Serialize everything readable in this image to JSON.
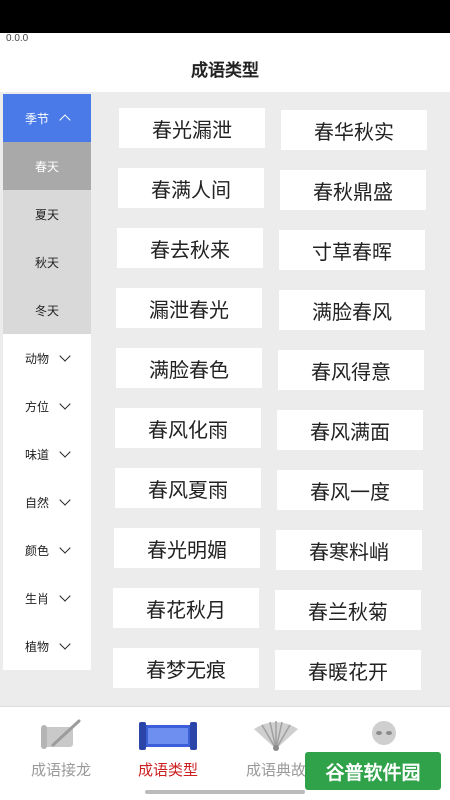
{
  "version": "0.0.0",
  "title": "成语类型",
  "sidebar": {
    "categories": [
      {
        "label": "季节",
        "expanded": true,
        "children": [
          "春天",
          "夏天",
          "秋天",
          "冬天"
        ],
        "selected": "春天"
      },
      {
        "label": "动物"
      },
      {
        "label": "方位"
      },
      {
        "label": "味道"
      },
      {
        "label": "自然"
      },
      {
        "label": "颜色"
      },
      {
        "label": "生肖"
      },
      {
        "label": "植物"
      }
    ]
  },
  "idioms": [
    "春光漏泄",
    "春华秋实",
    "春满人间",
    "春秋鼎盛",
    "春去秋来",
    "寸草春晖",
    "漏泄春光",
    "满脸春风",
    "满脸春色",
    "春风得意",
    "春风化雨",
    "春风满面",
    "春风夏雨",
    "春风一度",
    "春光明媚",
    "春寒料峭",
    "春花秋月",
    "春兰秋菊",
    "春梦无痕",
    "春暖花开"
  ],
  "tabs": [
    {
      "label": "成语接龙",
      "icon": "scroll-pen-icon",
      "active": false
    },
    {
      "label": "成语类型",
      "icon": "scroll-icon",
      "active": true
    },
    {
      "label": "成语典故",
      "icon": "folding-fan-icon",
      "active": false
    },
    {
      "label": "",
      "icon": "profile-icon",
      "active": false
    }
  ],
  "watermark": "谷普软件园",
  "colors": {
    "accent": "#4a7ae8",
    "active_tab": "#cc1f1f",
    "background": "#ececec"
  }
}
